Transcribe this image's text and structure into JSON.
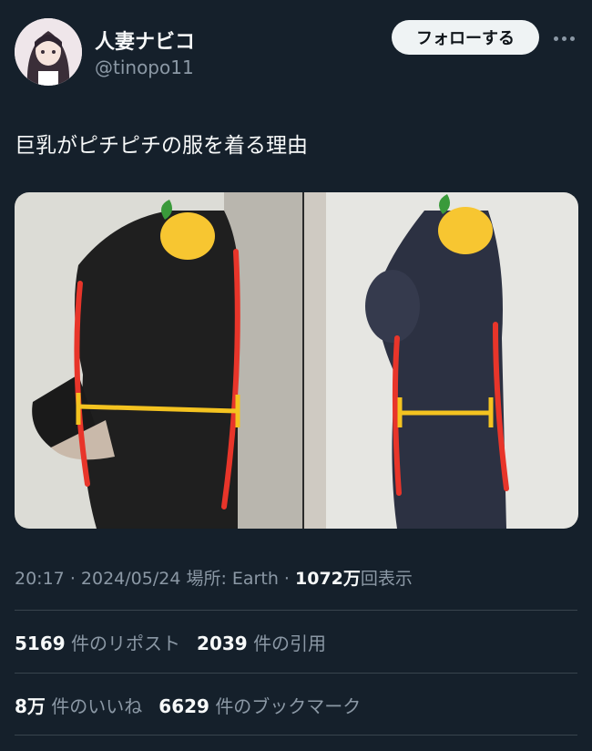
{
  "user": {
    "display_name": "人妻ナビコ",
    "handle": "@tinopo11",
    "follow_label": "フォローする"
  },
  "tweet": {
    "text": "巨乳がピチピチの服を着る理由"
  },
  "meta": {
    "time": "20:17",
    "date": "2024/05/24",
    "location": "場所: Earth",
    "views_count": "1072万",
    "views_label": "回表示"
  },
  "stats": {
    "reposts_count": "5169",
    "reposts_label": "件のリポスト",
    "quotes_count": "2039",
    "quotes_label": "件の引用",
    "likes_count": "8万",
    "likes_label": "件のいいね",
    "bookmarks_count": "6629",
    "bookmarks_label": "件のブックマーク"
  },
  "colors": {
    "background": "#15202b",
    "text": "#f7f9f9",
    "muted": "#8b98a5",
    "divider": "#38444d",
    "annotation_red": "#e8352a",
    "annotation_yellow": "#f4c320"
  }
}
